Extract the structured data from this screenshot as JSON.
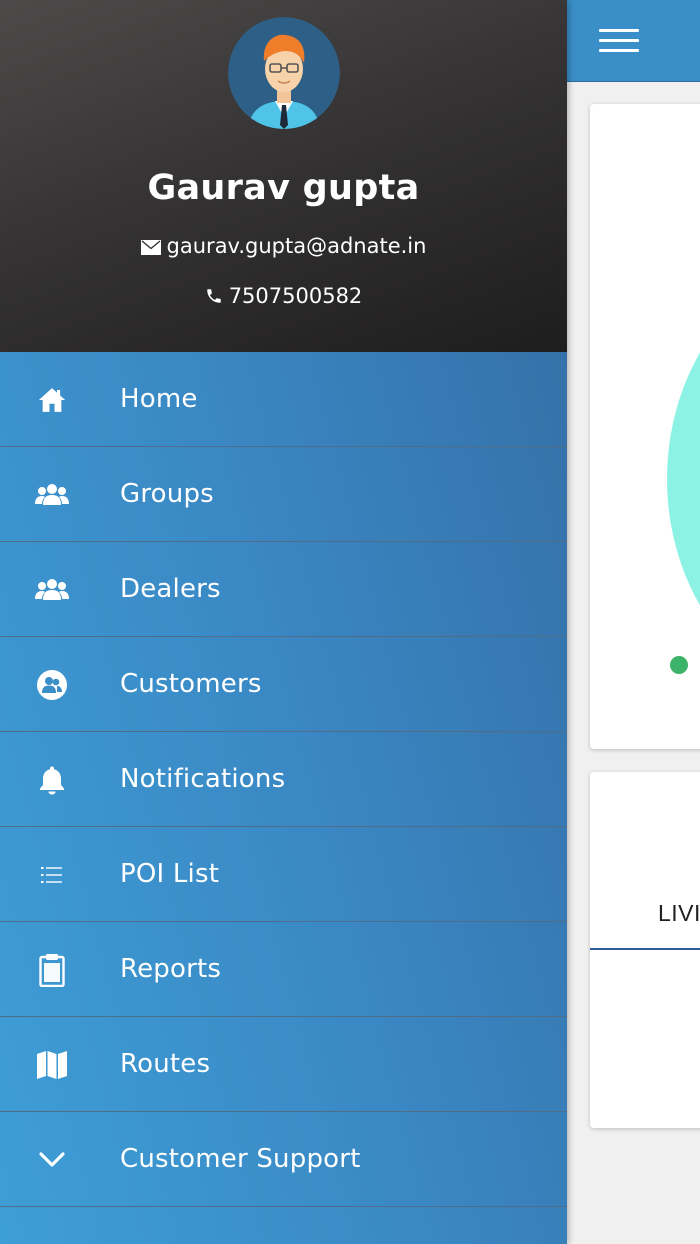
{
  "profile": {
    "name": "Gaurav gupta",
    "email": "gaurav.gupta@adnate.in",
    "phone": "7507500582"
  },
  "menu": {
    "items": [
      {
        "label": "Home",
        "icon": "home-icon"
      },
      {
        "label": "Groups",
        "icon": "groups-icon"
      },
      {
        "label": "Dealers",
        "icon": "dealers-icon"
      },
      {
        "label": "Customers",
        "icon": "customers-icon"
      },
      {
        "label": "Notifications",
        "icon": "bell-icon"
      },
      {
        "label": "POI List",
        "icon": "list-icon"
      },
      {
        "label": "Reports",
        "icon": "clipboard-icon"
      },
      {
        "label": "Routes",
        "icon": "map-icon"
      },
      {
        "label": "Customer Support",
        "icon": "chevron-down-icon"
      }
    ]
  },
  "background": {
    "tab_partial_label": "LIVI"
  },
  "colors": {
    "header_blue": "#3a8fc9",
    "menu_blue": "#3a87c3",
    "donut_teal": "#8cf3e4",
    "legend_green": "#3db36a"
  }
}
